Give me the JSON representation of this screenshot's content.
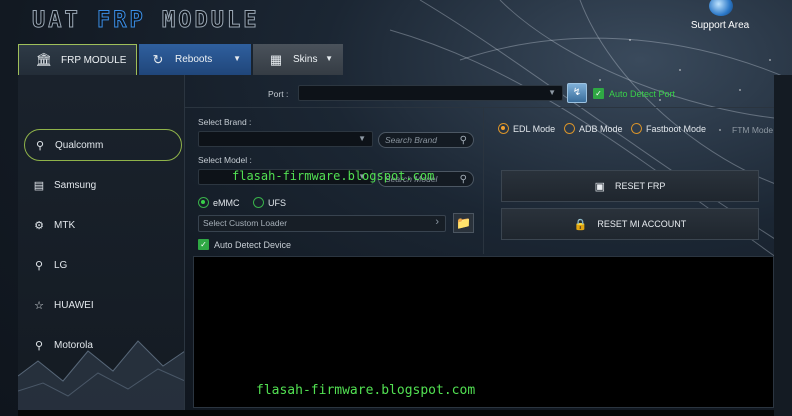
{
  "title": {
    "part1": "UAT ",
    "part2": "FRP",
    "part3": " MODULE"
  },
  "support_area": "Support Area",
  "tabs": [
    {
      "label": "FRP MODULE",
      "icon": "bank-icon"
    },
    {
      "label": "Reboots",
      "icon": "refresh-icon"
    },
    {
      "label": "Skins",
      "icon": "grid-icon"
    }
  ],
  "sidebar": {
    "items": [
      {
        "label": "Qualcomm",
        "icon": "pin-icon"
      },
      {
        "label": "Samsung",
        "icon": "map-icon"
      },
      {
        "label": "MTK",
        "icon": "gear-icon"
      },
      {
        "label": "LG",
        "icon": "pin-outline-icon"
      },
      {
        "label": "HUAWEI",
        "icon": "star-icon"
      },
      {
        "label": "Motorola",
        "icon": "pin-icon"
      }
    ]
  },
  "port": {
    "label": "Port :",
    "value": "",
    "auto_detect_label": "Auto Detect Port"
  },
  "brand": {
    "label": "Select Brand :",
    "search_placeholder": "Search Brand"
  },
  "model": {
    "label": "Select Model :",
    "search_placeholder": "Search Model"
  },
  "storage": {
    "option1": "eMMC",
    "option2": "UFS",
    "selected": "eMMC"
  },
  "loader": {
    "placeholder": "Select Custom Loader"
  },
  "auto_detect_device": "Auto Detect Device",
  "modes": {
    "edl": "EDL Mode",
    "adb": "ADB Mode",
    "fastboot": "Fastboot Mode",
    "ftm": "FTM Mode",
    "selected": "EDL Mode"
  },
  "actions": {
    "reset_frp": "RESET FRP",
    "reset_mi": "RESET MI ACCOUNT"
  },
  "watermark": "flasah-firmware.blogspot.com",
  "colors": {
    "accent_green": "#2fa844",
    "tab_blue": "#2f5f9e",
    "radio_orange": "#d8932a",
    "watermark": "#52e052"
  }
}
